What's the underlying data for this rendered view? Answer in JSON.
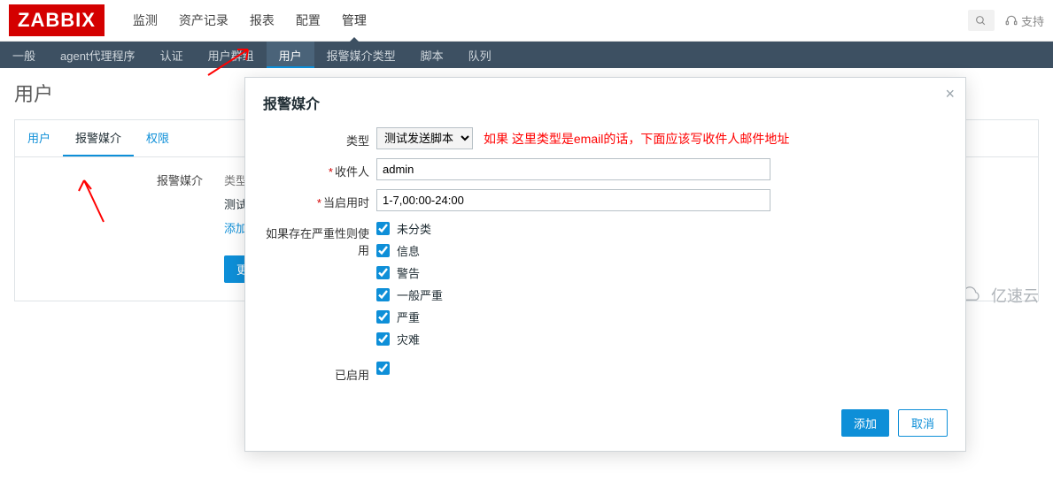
{
  "logo": "ZABBIX",
  "topnav": [
    "监测",
    "资产记录",
    "报表",
    "配置",
    "管理"
  ],
  "topnav_active": 4,
  "support_label": "支持",
  "subnav": [
    "一般",
    "agent代理程序",
    "认证",
    "用户群组",
    "用户",
    "报警媒介类型",
    "脚本",
    "队列"
  ],
  "subnav_active": 4,
  "page_title": "用户",
  "tabs": [
    "用户",
    "报警媒介",
    "权限"
  ],
  "tabs_active": 1,
  "bg": {
    "section_label": "报警媒介",
    "header_type": "类型",
    "row_text": "测试发",
    "add_link": "添加",
    "update_btn": "更新"
  },
  "modal": {
    "title": "报警媒介",
    "type_label": "类型",
    "type_value": "测试发送脚本",
    "type_hint": "如果 这里类型是email的话，下面应该写收件人邮件地址",
    "recipient_label": "收件人",
    "recipient_value": "admin",
    "when_label": "当启用时",
    "when_value": "1-7,00:00-24:00",
    "severity_label": "如果存在严重性则使用",
    "severities": [
      "未分类",
      "信息",
      "警告",
      "一般严重",
      "严重",
      "灾难"
    ],
    "enabled_label": "已启用",
    "add_btn": "添加",
    "cancel_btn": "取消"
  },
  "watermark": "亿速云"
}
